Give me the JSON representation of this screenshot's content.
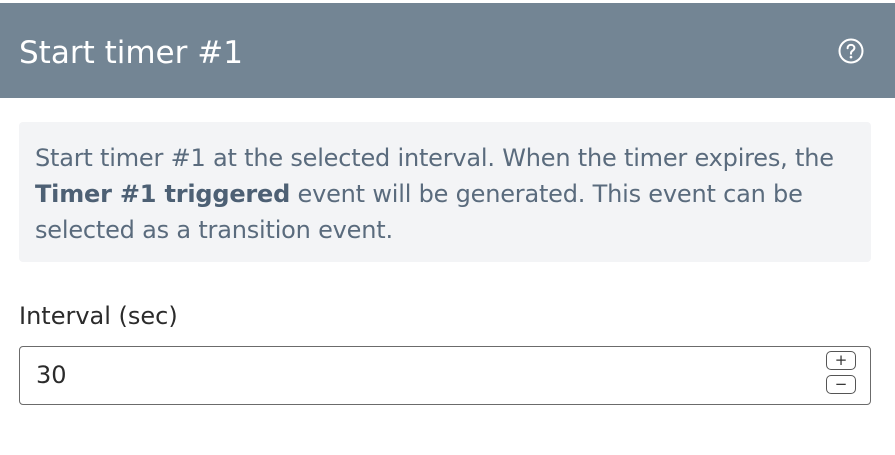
{
  "dialog": {
    "title": "Start timer #1",
    "help_icon": "question-circle-icon"
  },
  "description": {
    "part1": "Start timer #1 at the selected interval. When the timer expires, the ",
    "bold": "Timer #1 triggered",
    "part2": " event will be generated. This event can be selected as a transition event."
  },
  "interval": {
    "label": "Interval (sec)",
    "value": "30",
    "increment_glyph": "+",
    "decrement_glyph": "−"
  },
  "colors": {
    "header_bg": "#738594",
    "info_bg": "#f3f4f6",
    "info_text": "#5a6b7d"
  }
}
